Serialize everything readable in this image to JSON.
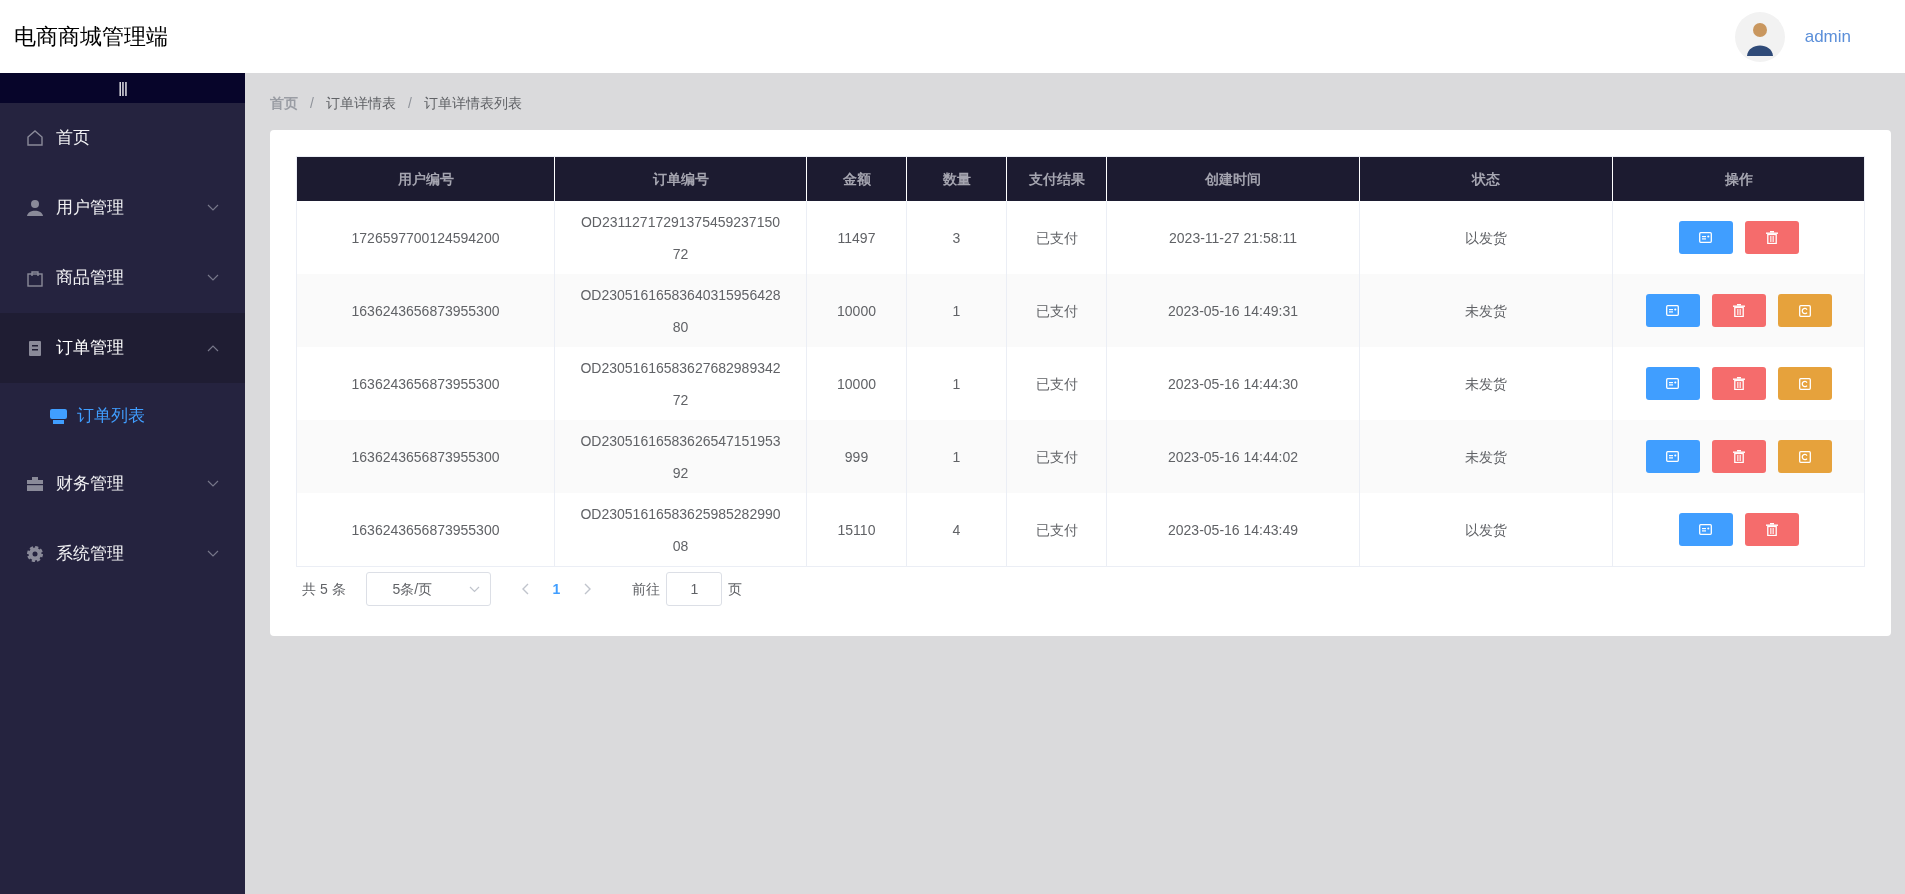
{
  "header": {
    "title": "电商商城管理端",
    "user": "admin"
  },
  "sidebar": {
    "toggle": "|||",
    "items": [
      {
        "label": "首页",
        "kind": "link",
        "active": false
      },
      {
        "label": "用户管理",
        "kind": "submenu",
        "expanded": false,
        "active": false
      },
      {
        "label": "商品管理",
        "kind": "submenu",
        "expanded": false,
        "active": false
      },
      {
        "label": "订单管理",
        "kind": "submenu",
        "expanded": true,
        "active": true,
        "children": [
          {
            "label": "订单列表",
            "selected": true
          }
        ]
      },
      {
        "label": "财务管理",
        "kind": "submenu",
        "expanded": false,
        "active": false
      },
      {
        "label": "系统管理",
        "kind": "submenu",
        "expanded": false,
        "active": false
      }
    ]
  },
  "breadcrumb": {
    "separator": "/",
    "items": [
      {
        "label": "首页"
      },
      {
        "label": "订单详情表"
      },
      {
        "label": "订单详情表列表"
      }
    ]
  },
  "table": {
    "columns": [
      "用户编号",
      "订单编号",
      "金额",
      "数量",
      "支付结果",
      "创建时间",
      "状态",
      "操作"
    ],
    "rows": [
      {
        "cells": [
          "1726597700124594200",
          "OD2311271729137545923715072",
          "11497",
          "3",
          "已支付",
          "2023-11-27 21:58:11",
          "以发货"
        ],
        "actions": [
          {
            "kind": "view"
          },
          {
            "kind": "delete"
          }
        ]
      },
      {
        "cells": [
          "1636243656873955300",
          "OD2305161658364031595642880",
          "10000",
          "1",
          "已支付",
          "2023-05-16 14:49:31",
          "未发货"
        ],
        "actions": [
          {
            "kind": "view"
          },
          {
            "kind": "delete"
          },
          {
            "kind": "ship"
          }
        ]
      },
      {
        "cells": [
          "1636243656873955300",
          "OD2305161658362768298934272",
          "10000",
          "1",
          "已支付",
          "2023-05-16 14:44:30",
          "未发货"
        ],
        "actions": [
          {
            "kind": "view"
          },
          {
            "kind": "delete"
          },
          {
            "kind": "ship"
          }
        ]
      },
      {
        "cells": [
          "1636243656873955300",
          "OD2305161658362654715195392",
          "999",
          "1",
          "已支付",
          "2023-05-16 14:44:02",
          "未发货"
        ],
        "actions": [
          {
            "kind": "view"
          },
          {
            "kind": "delete"
          },
          {
            "kind": "ship"
          }
        ]
      },
      {
        "cells": [
          "1636243656873955300",
          "OD2305161658362598528299008",
          "15110",
          "4",
          "已支付",
          "2023-05-16 14:43:49",
          "以发货"
        ],
        "actions": [
          {
            "kind": "view"
          },
          {
            "kind": "delete"
          }
        ]
      }
    ]
  },
  "pagination": {
    "total": "共 5 条",
    "page_size": "5条/页",
    "pages": [
      {
        "label": "1",
        "selected": true
      }
    ],
    "goto_label": "前往",
    "goto_value": "1",
    "page_suffix": "页"
  }
}
